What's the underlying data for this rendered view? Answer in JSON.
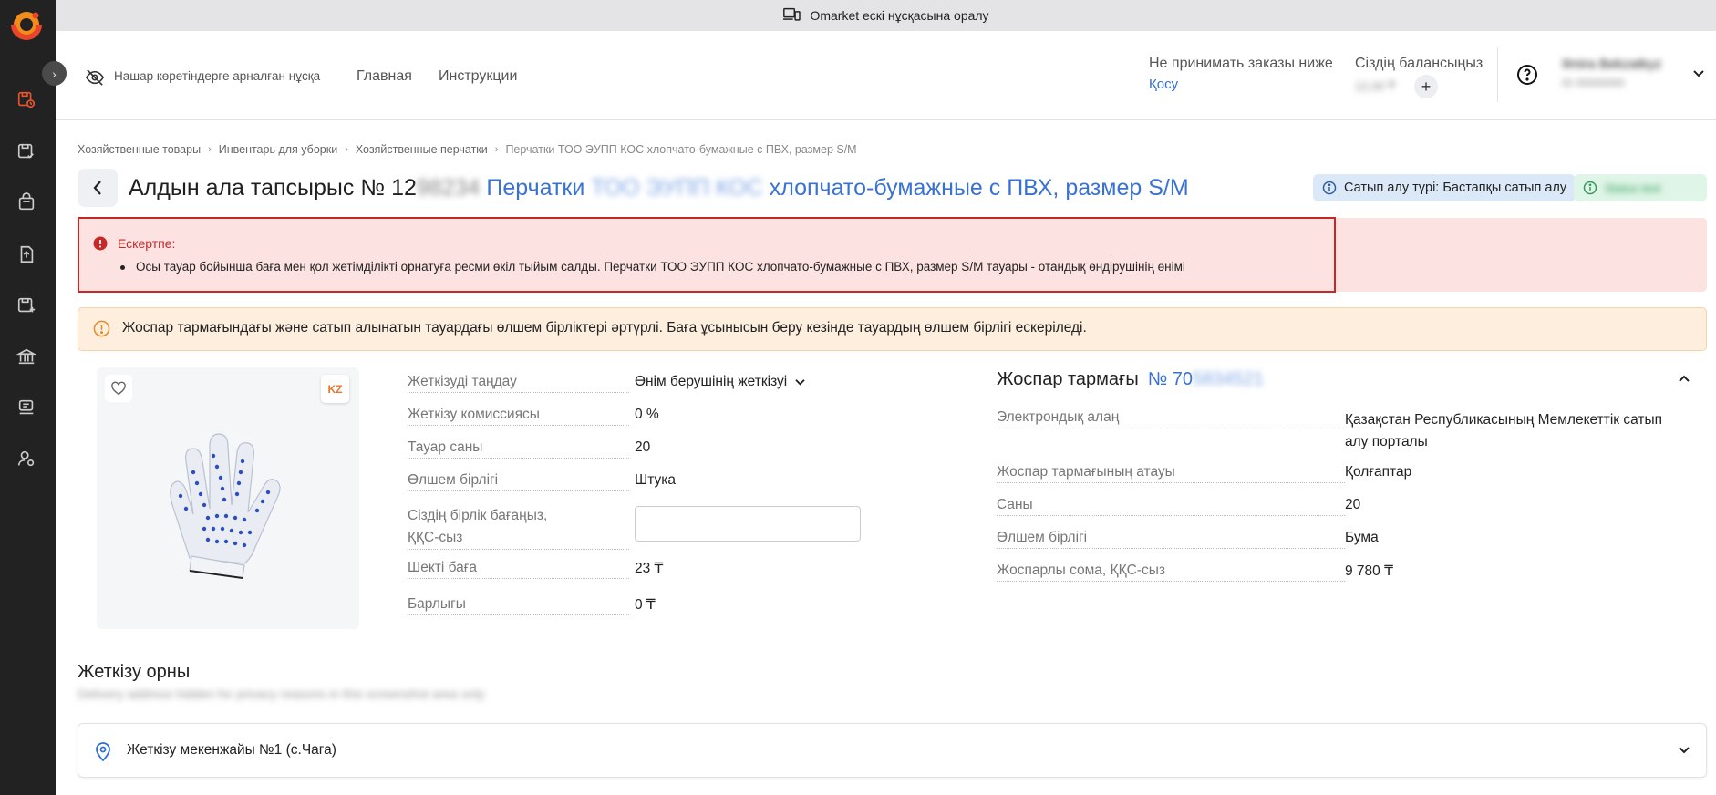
{
  "topbar": {
    "text": "Omarket ескі нұсқасына оралу"
  },
  "header": {
    "accessibility": "Нашар көретіндерге арналған нұсқа",
    "nav": [
      "Главная",
      "Инструкции"
    ],
    "min_order_label": "Не принимать заказы ниже",
    "min_order_action": "Қосу",
    "balance_label": "Сіздің балансыңыз",
    "balance_value": "12,00 ₸",
    "user_name": "Ilmira Bekzatkyz",
    "user_sub": "ID 00000000"
  },
  "breadcrumb": [
    "Хозяйственные товары",
    "Инвентарь для уборки",
    "Хозяйственные перчатки",
    "Перчатки ТОО ЭУПП КОС хлопчато-бумажные с ПВХ, размер S/M"
  ],
  "title": {
    "prefix": "Алдын ала тапсырыс № 12",
    "hidden_number": "98234",
    "link_start": "Перчатки ",
    "link_hidden": "ТОО ЭУПП КОС",
    "link_end": " хлопчато-бумажные с ПВХ, размер S/M"
  },
  "purchase_type": "Сатып алу түрі: Бастапқы сатып алу",
  "status_badge": "Status text",
  "warning": {
    "title": "Ескертпе:",
    "text": "Осы тауар бойынша баға мен қол жетімділікті орнатуға ресми өкіл тыйым салды. Перчатки ТОО ЭУПП КОС хлопчато-бумажные с ПВХ, размер S/M тауары - отандық өндірушінің өнімі"
  },
  "notice": "Жоспар тармағындағы және сатып алынатын тауардағы өлшем бірліктері әртүрлі. Баға ұсынысын беру кезінде тауардың өлшем бірлігі ескеріледі.",
  "product": {
    "badge": "KZ"
  },
  "order": {
    "delivery_choice_label": "Жеткізуді таңдау",
    "delivery_choice_value": "Өнім берушінің жеткізуі",
    "commission_label": "Жеткізу комиссиясы",
    "commission_value": "0 %",
    "quantity_label": "Тауар саны",
    "quantity_value": "20",
    "unit_label": "Өлшем бірлігі",
    "unit_value": "Штука",
    "price_label_1": "Сіздің бірлік бағаңыз,",
    "price_label_2": "ҚҚС-сыз",
    "price_value": "",
    "limit_label": "Шекті баға",
    "limit_value": "23 ₸",
    "total_label": "Барлығы",
    "total_value": "0 ₸"
  },
  "plan": {
    "title": "Жоспар тармағы",
    "number_visible": "№ 70",
    "number_hidden": "5834521",
    "platform_label": "Электрондық алаң",
    "platform_value_1": "Қазақстан Республикасының Мемлекеттік сатып",
    "platform_value_2": "алу порталы",
    "name_label": "Жоспар тармағының атауы",
    "name_value": "Қолғаптар",
    "qty_label": "Саны",
    "qty_value": "20",
    "unit_label": "Өлшем бірлігі",
    "unit_value": "Бума",
    "sum_label": "Жоспарлы сома, ҚҚС-сыз",
    "sum_value": "9 780 ₸"
  },
  "delivery": {
    "title": "Жеткізу орны",
    "address_hidden": "Delivery address hidden for privacy reasons in this screenshot area only",
    "address_label": "Жеткізу мекенжайы №1 (с.Чага)"
  },
  "colors": {
    "accent": "#3a72d4",
    "sidebar": "#222222",
    "sidebar_icon": "#e8552a",
    "error": "#c62828"
  }
}
